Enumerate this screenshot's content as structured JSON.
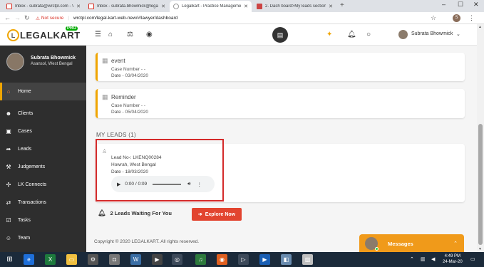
{
  "browser": {
    "tabs": [
      {
        "title": "Inbox - subrata@wrctpl.com - Wr...",
        "favicon": "gmail-icon"
      },
      {
        "title": "Inbox - subrata.bhowmick@legalk...",
        "favicon": "gmail-icon"
      },
      {
        "title": "Legalkart - Practice Management...",
        "favicon": "legalkart-icon",
        "active": true
      },
      {
        "title": "2. Dash board>My leads section...",
        "favicon": "dashboard-icon"
      }
    ],
    "security_label": "Not secure",
    "url": "wrctpl.com/legal-kart-web-new/#/lawyer/dashboard",
    "profile_initial": "S"
  },
  "app": {
    "logo_text": "LEGALKART",
    "logo_letter": "L",
    "logo_badge": "PRO",
    "user_name": "Subrata Bhowmick"
  },
  "sidebar": {
    "profile_name": "Subrata Bhowmick",
    "profile_location": "Asansol, West Bengal",
    "items": [
      {
        "label": "Home",
        "icon": "home-icon",
        "active": true
      },
      {
        "label": "Clients",
        "icon": "users-icon"
      },
      {
        "label": "Cases",
        "icon": "briefcase-icon"
      },
      {
        "label": "Leads",
        "icon": "leads-icon"
      },
      {
        "label": "Judgements",
        "icon": "gavel-icon"
      },
      {
        "label": "LK Connects",
        "icon": "network-icon"
      },
      {
        "label": "Transactions",
        "icon": "transactions-icon"
      },
      {
        "label": "Tasks",
        "icon": "tasks-icon"
      },
      {
        "label": "Team",
        "icon": "team-icon"
      }
    ]
  },
  "events": [
    {
      "title": "event",
      "case_number": "Case Number - -",
      "date": "Date - 03/04/2020"
    },
    {
      "title": "Reminder",
      "case_number": "Case Number - -",
      "date": "Date - 05/04/2020"
    }
  ],
  "leads": {
    "section_title": "MY LEADS (1)",
    "item": {
      "lead_no": "Lead No-: LKENQ00284",
      "location": "Howrah, West Bengal",
      "date": "Date - 18/03/2020",
      "audio_time": "0:00 / 0:09"
    },
    "waiting_text": "2 Leads Waiting For You",
    "explore_label": "Explore Now"
  },
  "footer": {
    "copyright": "Copyright © 2020 LEGALKART. All rights reserved."
  },
  "messages_widget": {
    "label": "Messages"
  },
  "taskbar": {
    "time": "4:49 PM",
    "date": "24-Mar-20"
  },
  "colors": {
    "accent": "#f0a500",
    "sidebar_bg": "#2e2e2e",
    "explore_btn": "#e2442f",
    "highlight_box": "#d42a2a",
    "messages_bg": "#f09a1a"
  }
}
